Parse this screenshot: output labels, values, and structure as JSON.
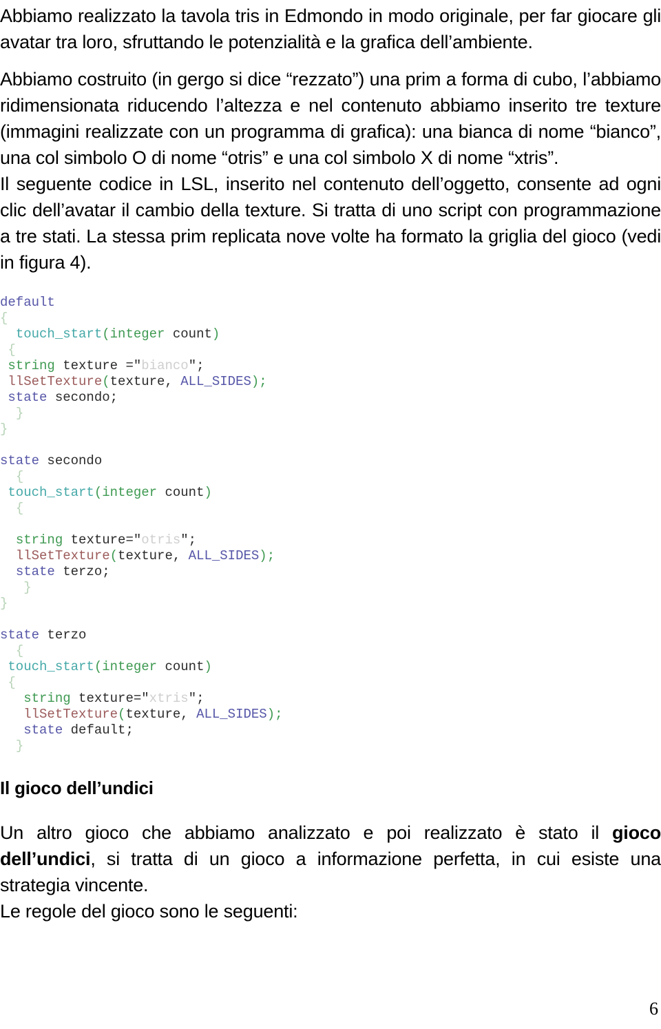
{
  "document": {
    "page_number": "6",
    "paragraphs": {
      "intro": "Abbiamo realizzato la tavola tris in Edmondo in modo originale, per far giocare gli avatar tra loro, sfruttando le potenzialità e la grafica dell’ambiente.",
      "build": "Abbiamo costruito (in gergo si dice “rezzato”) una prim a forma di cubo, l’abbiamo ridimensionata riducendo l’altezza e nel contenuto abbiamo inserito tre texture (immagini realizzate con un programma di grafica): una bianca di nome “bianco”, una col simbolo O di nome “otris” e una col simbolo X di nome “xtris”.",
      "code_description": "Il seguente codice in LSL, inserito nel contenuto dell’oggetto, consente ad ogni clic dell’avatar il cambio della texture. Si tratta di uno script con programmazione a tre stati. La stessa prim replicata nove volte ha formato la griglia del gioco (vedi in figura 4).",
      "regole": "Le regole del gioco sono le seguenti:"
    },
    "heading_undici": "Il gioco dell’undici",
    "undici_paragraph": {
      "before_bold": "Un altro gioco che abbiamo analizzato e poi realizzato è stato il ",
      "bold": "gioco dell’undici",
      "after_bold": ", si tratta di un gioco a informazione perfetta, in cui esiste una strategia vincente."
    }
  },
  "code_block": {
    "language": "LSL",
    "colors": {
      "state_keyword": "#5656a8",
      "event_name": "#45a8a8",
      "type_keyword": "#3f9a52",
      "brace": "#b7d3b7",
      "function_name": "#9c5b5b",
      "string_literal": "#cfcfcf",
      "plain": "#2b2b2b"
    },
    "lines": [
      {
        "indent": "",
        "tokens": [
          {
            "t": "default",
            "c": "tok-state"
          }
        ]
      },
      {
        "indent": "",
        "tokens": [
          {
            "t": "{",
            "c": "tok-punct"
          }
        ]
      },
      {
        "indent": "  ",
        "tokens": [
          {
            "t": "touch_start",
            "c": "tok-event"
          },
          {
            "t": "(",
            "c": "tok-type"
          },
          {
            "t": "integer",
            "c": "tok-type"
          },
          {
            "t": " count",
            "c": "tok-plain"
          },
          {
            "t": ")",
            "c": "tok-type"
          }
        ]
      },
      {
        "indent": " ",
        "tokens": [
          {
            "t": "{",
            "c": "tok-punct"
          }
        ]
      },
      {
        "indent": " ",
        "tokens": [
          {
            "t": "string",
            "c": "tok-type"
          },
          {
            "t": " texture =",
            "c": "tok-plain"
          },
          {
            "t": "\"",
            "c": "tok-plain"
          },
          {
            "t": "bianco",
            "c": "tok-str"
          },
          {
            "t": "\";",
            "c": "tok-plain"
          }
        ]
      },
      {
        "indent": " ",
        "tokens": [
          {
            "t": "llSetTexture",
            "c": "tok-func"
          },
          {
            "t": "(",
            "c": "tok-type"
          },
          {
            "t": "texture, ",
            "c": "tok-plain"
          },
          {
            "t": "ALL_SIDES",
            "c": "tok-state"
          },
          {
            "t": ");",
            "c": "tok-green"
          }
        ]
      },
      {
        "indent": " ",
        "tokens": [
          {
            "t": "state",
            "c": "tok-state"
          },
          {
            "t": " secondo;",
            "c": "tok-plain"
          }
        ]
      },
      {
        "indent": "  ",
        "tokens": [
          {
            "t": "}",
            "c": "tok-punct"
          }
        ]
      },
      {
        "indent": "",
        "tokens": [
          {
            "t": "}",
            "c": "tok-punct"
          }
        ]
      },
      {
        "indent": "",
        "tokens": []
      },
      {
        "indent": "",
        "tokens": [
          {
            "t": "state",
            "c": "tok-state"
          },
          {
            "t": " secondo",
            "c": "tok-plain"
          }
        ]
      },
      {
        "indent": "  ",
        "tokens": [
          {
            "t": "{",
            "c": "tok-punct"
          }
        ]
      },
      {
        "indent": " ",
        "tokens": [
          {
            "t": "touch_start",
            "c": "tok-event"
          },
          {
            "t": "(",
            "c": "tok-type"
          },
          {
            "t": "integer",
            "c": "tok-type"
          },
          {
            "t": " count",
            "c": "tok-plain"
          },
          {
            "t": ")",
            "c": "tok-type"
          }
        ]
      },
      {
        "indent": "  ",
        "tokens": [
          {
            "t": "{",
            "c": "tok-punct"
          }
        ]
      },
      {
        "indent": "",
        "tokens": []
      },
      {
        "indent": "  ",
        "tokens": [
          {
            "t": "string",
            "c": "tok-type"
          },
          {
            "t": " texture=",
            "c": "tok-plain"
          },
          {
            "t": "\"",
            "c": "tok-plain"
          },
          {
            "t": "otris",
            "c": "tok-str"
          },
          {
            "t": "\";",
            "c": "tok-plain"
          }
        ]
      },
      {
        "indent": "  ",
        "tokens": [
          {
            "t": "llSetTexture",
            "c": "tok-func"
          },
          {
            "t": "(",
            "c": "tok-type"
          },
          {
            "t": "texture, ",
            "c": "tok-plain"
          },
          {
            "t": "ALL_SIDES",
            "c": "tok-state"
          },
          {
            "t": ");",
            "c": "tok-green"
          }
        ]
      },
      {
        "indent": "  ",
        "tokens": [
          {
            "t": "state",
            "c": "tok-state"
          },
          {
            "t": " terzo;",
            "c": "tok-plain"
          }
        ]
      },
      {
        "indent": "   ",
        "tokens": [
          {
            "t": "}",
            "c": "tok-punct"
          }
        ]
      },
      {
        "indent": "",
        "tokens": [
          {
            "t": "}",
            "c": "tok-punct"
          }
        ]
      },
      {
        "indent": "",
        "tokens": []
      },
      {
        "indent": "",
        "tokens": [
          {
            "t": "state",
            "c": "tok-state"
          },
          {
            "t": " terzo",
            "c": "tok-plain"
          }
        ]
      },
      {
        "indent": "  ",
        "tokens": [
          {
            "t": "{",
            "c": "tok-punct"
          }
        ]
      },
      {
        "indent": " ",
        "tokens": [
          {
            "t": "touch_start",
            "c": "tok-event"
          },
          {
            "t": "(",
            "c": "tok-type"
          },
          {
            "t": "integer",
            "c": "tok-type"
          },
          {
            "t": " count",
            "c": "tok-plain"
          },
          {
            "t": ")",
            "c": "tok-type"
          }
        ]
      },
      {
        "indent": " ",
        "tokens": [
          {
            "t": "{",
            "c": "tok-punct"
          }
        ]
      },
      {
        "indent": "   ",
        "tokens": [
          {
            "t": "string",
            "c": "tok-type"
          },
          {
            "t": " texture=",
            "c": "tok-plain"
          },
          {
            "t": "\"",
            "c": "tok-plain"
          },
          {
            "t": "xtris",
            "c": "tok-str"
          },
          {
            "t": "\";",
            "c": "tok-plain"
          }
        ]
      },
      {
        "indent": "   ",
        "tokens": [
          {
            "t": "llSetTexture",
            "c": "tok-func"
          },
          {
            "t": "(",
            "c": "tok-type"
          },
          {
            "t": "texture, ",
            "c": "tok-plain"
          },
          {
            "t": "ALL_SIDES",
            "c": "tok-state"
          },
          {
            "t": ");",
            "c": "tok-green"
          }
        ]
      },
      {
        "indent": "   ",
        "tokens": [
          {
            "t": "state",
            "c": "tok-state"
          },
          {
            "t": " default;",
            "c": "tok-plain"
          }
        ]
      },
      {
        "indent": "  ",
        "tokens": [
          {
            "t": "}",
            "c": "tok-punct"
          }
        ]
      }
    ]
  }
}
